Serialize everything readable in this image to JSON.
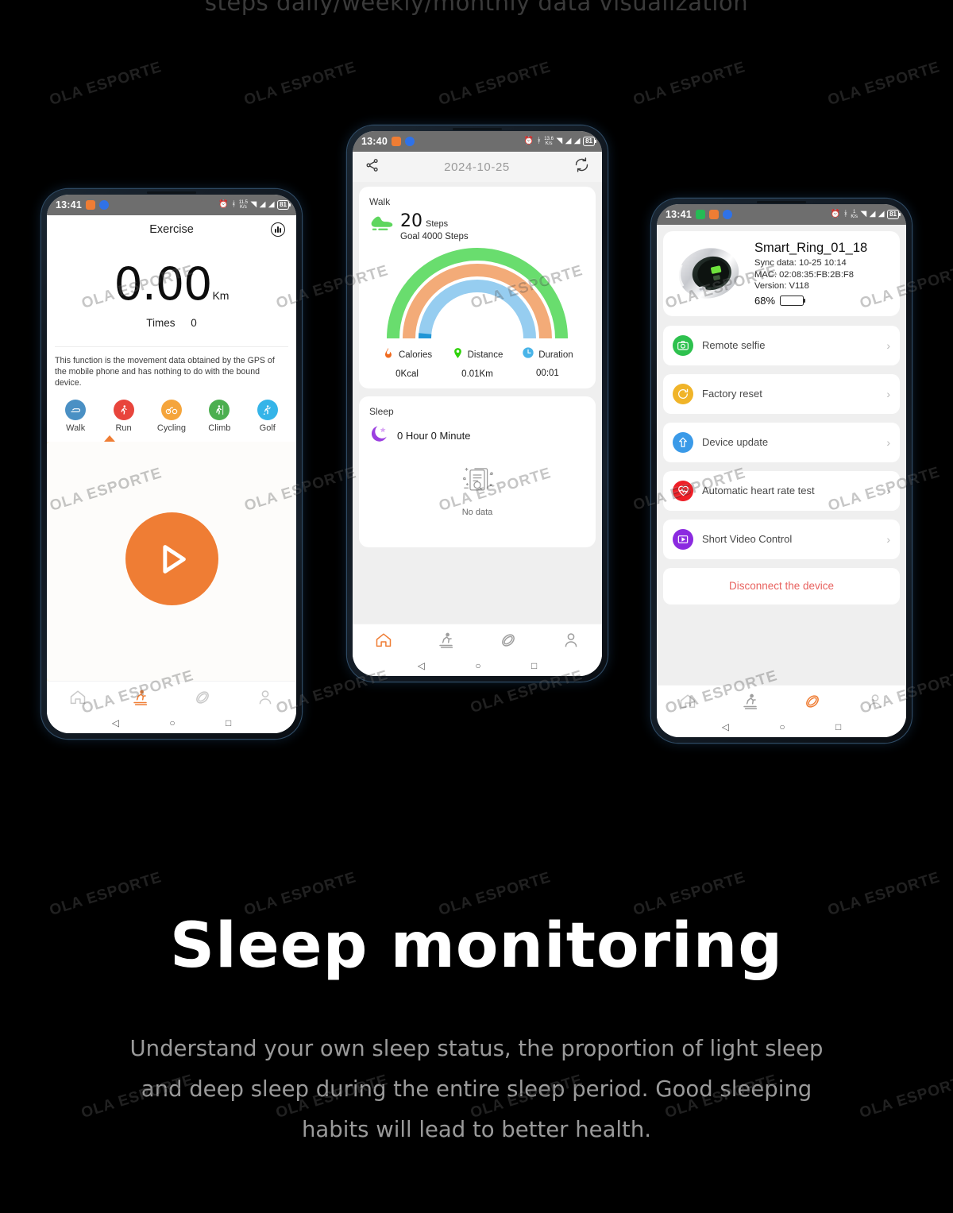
{
  "top_caption": "steps daily/weekly/monthly data visualization",
  "watermark": {
    "text": "OLA ESPORTE"
  },
  "headline": "Sleep monitoring",
  "subtext": "Understand your own sleep status, the proportion of light sleep and deep sleep during the entire sleep period. Good sleeping habits will lead to better health.",
  "colors": {
    "accent_orange": "#ef7d34",
    "arc_green": "#69dd6e",
    "arc_orange": "#f3ab78",
    "arc_blue": "#96cdf0",
    "arc_blue_dark": "#2196d6",
    "battery_green": "#17cc17",
    "disconnect_red": "#e8625f"
  },
  "phone_left": {
    "status_bar": {
      "time": "13:41",
      "badges": [
        "orange-message-badge",
        "blue-app-badge"
      ],
      "icons": [
        "alarm-icon",
        "bluetooth-icon",
        "wifi-icon",
        "signal-icon",
        "signal-icon"
      ],
      "net_speed_value": "11.5",
      "net_speed_unit": "K/s",
      "battery": "81"
    },
    "header": {
      "title": "Exercise",
      "chart_icon": "bar-chart-icon"
    },
    "distance": {
      "value": "0.00",
      "unit": "Km"
    },
    "times": {
      "label": "Times",
      "value": "0"
    },
    "note": "This function is the movement data obtained by the GPS of the mobile phone and has nothing to do with the bound device.",
    "sports": [
      {
        "label": "Walk",
        "icon": "walk-icon",
        "color": "#4a90c4",
        "selected": true
      },
      {
        "label": "Run",
        "icon": "run-icon",
        "color": "#e8453c",
        "selected": false
      },
      {
        "label": "Cycling",
        "icon": "cycling-icon",
        "color": "#f5a53c",
        "selected": false
      },
      {
        "label": "Climb",
        "icon": "climb-icon",
        "color": "#4caf50",
        "selected": false
      },
      {
        "label": "Golf",
        "icon": "golf-icon",
        "color": "#35b4e8",
        "selected": false
      }
    ],
    "play_button": "start-exercise-play-button",
    "tabs": [
      {
        "name": "home",
        "active": false
      },
      {
        "name": "sport",
        "active": true
      },
      {
        "name": "device",
        "active": false
      },
      {
        "name": "profile",
        "active": false
      }
    ]
  },
  "phone_mid": {
    "status_bar": {
      "time": "13:40",
      "badges": [
        "orange-message-badge",
        "blue-app-badge"
      ],
      "net_speed_value": "13.6",
      "net_speed_unit": "K/s",
      "battery": "81"
    },
    "header": {
      "share_icon": "share-icon",
      "date": "2024-10-25",
      "refresh_icon": "refresh-icon"
    },
    "walk_card": {
      "title": "Walk",
      "steps_value": "20",
      "steps_unit": "Steps",
      "goal": "Goal 4000 Steps",
      "metrics": [
        {
          "name": "Calories",
          "value": "0Kcal",
          "icon": "flame-icon",
          "color": "#f06a1e"
        },
        {
          "name": "Distance",
          "value": "0.01Km",
          "icon": "location-pin-icon",
          "color": "#2fd20a"
        },
        {
          "name": "Duration",
          "value": "00:01",
          "icon": "clock-icon",
          "color": "#49b4e8"
        }
      ]
    },
    "sleep_card": {
      "title": "Sleep",
      "value": "0 Hour 0 Minute",
      "empty_text": "No data",
      "empty_icon": "no-data-document-icon"
    },
    "tabs": [
      {
        "name": "home",
        "active": true
      },
      {
        "name": "sport",
        "active": false
      },
      {
        "name": "device",
        "active": false
      },
      {
        "name": "profile",
        "active": false
      }
    ]
  },
  "phone_right": {
    "status_bar": {
      "time": "13:41",
      "badges": [
        "green-call-badge",
        "orange-message-badge",
        "blue-app-badge"
      ],
      "net_speed_value": "1",
      "net_speed_unit": "K/s",
      "battery": "81"
    },
    "device": {
      "name": "Smart_Ring_01_18",
      "sync": "Sync data: 10-25 10:14",
      "mac": "MAC: 02:08:35:FB:2B:F8",
      "version": "Version: V118",
      "battery_pct": "68%",
      "battery_fill": 68,
      "image": "smart-ring-photo"
    },
    "menu": [
      {
        "label": "Remote selfie",
        "icon": "camera-icon",
        "color": "#2ec14e"
      },
      {
        "label": "Factory reset",
        "icon": "reset-icon",
        "color": "#f0b429"
      },
      {
        "label": "Device update",
        "icon": "upload-arrow-icon",
        "color": "#3a9ae8"
      },
      {
        "label": "Automatic heart rate test",
        "icon": "heart-rate-icon",
        "color": "#ee1f27"
      },
      {
        "label": "Short Video Control",
        "icon": "video-play-icon",
        "color": "#8b2ae0"
      }
    ],
    "disconnect": "Disconnect the device",
    "tabs": [
      {
        "name": "home",
        "active": false
      },
      {
        "name": "sport",
        "active": false
      },
      {
        "name": "device",
        "active": true
      },
      {
        "name": "profile",
        "active": false
      }
    ]
  },
  "chart_data": {
    "type": "pie",
    "title": "Walk steps progress gauge",
    "subtitle": "Goal 4000 Steps",
    "series": [
      {
        "name": "Outer ring (green)",
        "value": 100,
        "color": "#69dd6e"
      },
      {
        "name": "Middle ring (orange)",
        "value": 100,
        "color": "#f3ab78"
      },
      {
        "name": "Inner ring (light blue)",
        "value": 97,
        "color": "#96cdf0"
      },
      {
        "name": "Inner ring progress (blue)",
        "value": 3,
        "color": "#2196d6"
      }
    ],
    "annotations": [
      "20 Steps",
      "Goal 4000 Steps"
    ],
    "legend": "none",
    "grid": false
  }
}
